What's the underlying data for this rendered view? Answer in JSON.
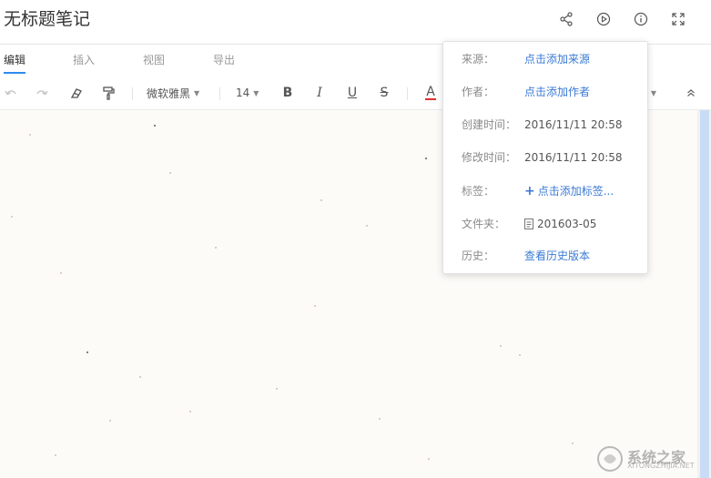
{
  "note": {
    "title": "无标题笔记"
  },
  "title_actions": [
    {
      "name": "share-icon"
    },
    {
      "name": "play-icon"
    },
    {
      "name": "info-icon"
    },
    {
      "name": "fullscreen-icon"
    }
  ],
  "tabs": [
    {
      "label": "编辑",
      "active": true
    },
    {
      "label": "插入",
      "active": false
    },
    {
      "label": "视图",
      "active": false
    },
    {
      "label": "导出",
      "active": false
    }
  ],
  "toolbar": {
    "font_family": "微软雅黑",
    "font_size": "14",
    "bold": "B",
    "italic": "I",
    "underline": "U",
    "strike": "S",
    "font_color_letter": "A",
    "font_color": "#e0312f"
  },
  "info_panel": {
    "source_label": "来源：",
    "source_value": "点击添加来源",
    "author_label": "作者：",
    "author_value": "点击添加作者",
    "created_label": "创建时间：",
    "created_value": "2016/11/11 20:58",
    "modified_label": "修改时间：",
    "modified_value": "2016/11/11 20:58",
    "tags_label": "标签：",
    "tags_value": "点击添加标签...",
    "folder_label": "文件夹：",
    "folder_value": "201603-05",
    "history_label": "历史：",
    "history_value": "查看历史版本"
  },
  "watermark": {
    "text": "系统之家",
    "sub": "XITONGZHIJIA.NET"
  },
  "colors": {
    "accent": "#2d8cf0",
    "link": "#3b7bd4",
    "paper": "#fcfbf8"
  }
}
